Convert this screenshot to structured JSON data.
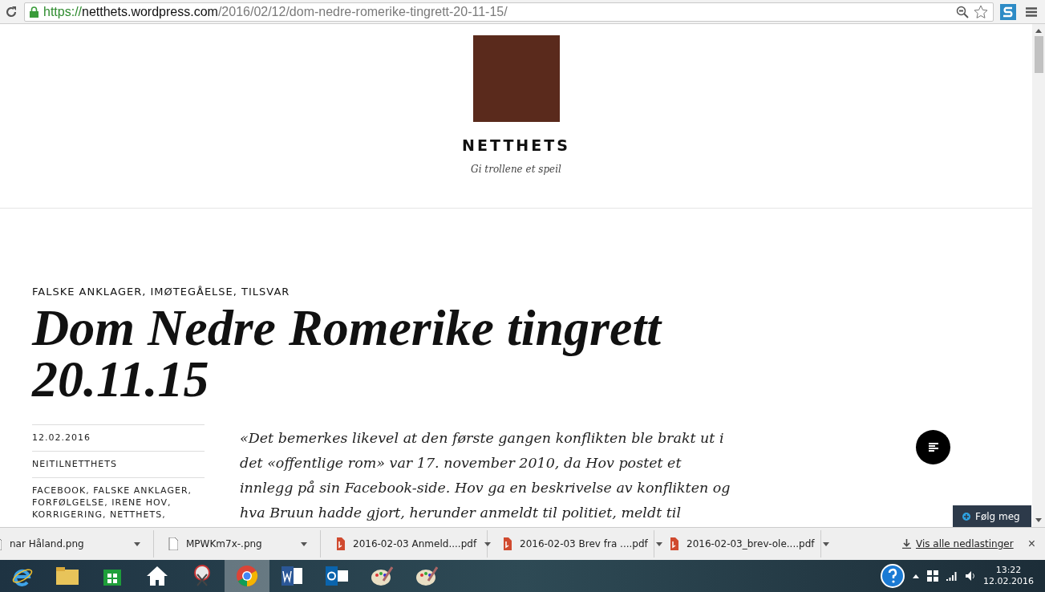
{
  "browser": {
    "url_scheme": "https://",
    "url_host": "netthets.wordpress.com",
    "url_path": "/2016/02/12/dom-nedre-romerike-tingrett-20-11-15/"
  },
  "site": {
    "title": "NETTHETS",
    "tagline": "Gi trollene et speil"
  },
  "post": {
    "categories": "FALSKE ANKLAGER, IMØTEGÅELSE, TILSVAR",
    "title": "Dom Nedre Romerike tingrett 20.11.15",
    "date": "12.02.2016",
    "author": "NEITILNETTHETS",
    "tags": "FACEBOOK, FALSKE ANKLAGER, FORFØLGELSE, IRENE HOV, KORRIGERING, NETTHETS,",
    "excerpt": "«Det bemerkes likevel at den første gangen konflikten ble brakt ut i det «offentlige rom» var 17. november 2010, da Hov postet et innlegg på sin Facebook-side. Hov ga en beskrivelse av konflikten og hva Bruun hadde gjort, herunder anmeldt til politiet, meldt til"
  },
  "follow_button": "Følg meg",
  "downloads": {
    "items": [
      {
        "name": "nar Håland.png",
        "kind": "image"
      },
      {
        "name": "MPWKm7x-.png",
        "kind": "image"
      },
      {
        "name": "2016-02-03 Anmeld....pdf",
        "kind": "pdf"
      },
      {
        "name": "2016-02-03 Brev fra ....pdf",
        "kind": "pdf"
      },
      {
        "name": "2016-02-03_brev-ole....pdf",
        "kind": "pdf"
      }
    ],
    "show_all": "Vis alle nedlastinger",
    "close": "×"
  },
  "taskbar": {
    "apps": [
      {
        "kind": "ie",
        "selected": false
      },
      {
        "kind": "folder",
        "selected": false
      },
      {
        "kind": "store",
        "selected": false
      },
      {
        "kind": "home",
        "selected": false
      },
      {
        "kind": "snip",
        "selected": false
      },
      {
        "kind": "chrome",
        "selected": true
      },
      {
        "kind": "word",
        "selected": false
      },
      {
        "kind": "outlook",
        "selected": false
      },
      {
        "kind": "paint",
        "selected": false
      },
      {
        "kind": "paint",
        "selected": false
      }
    ],
    "time": "13:22",
    "date": "12.02.2016"
  }
}
